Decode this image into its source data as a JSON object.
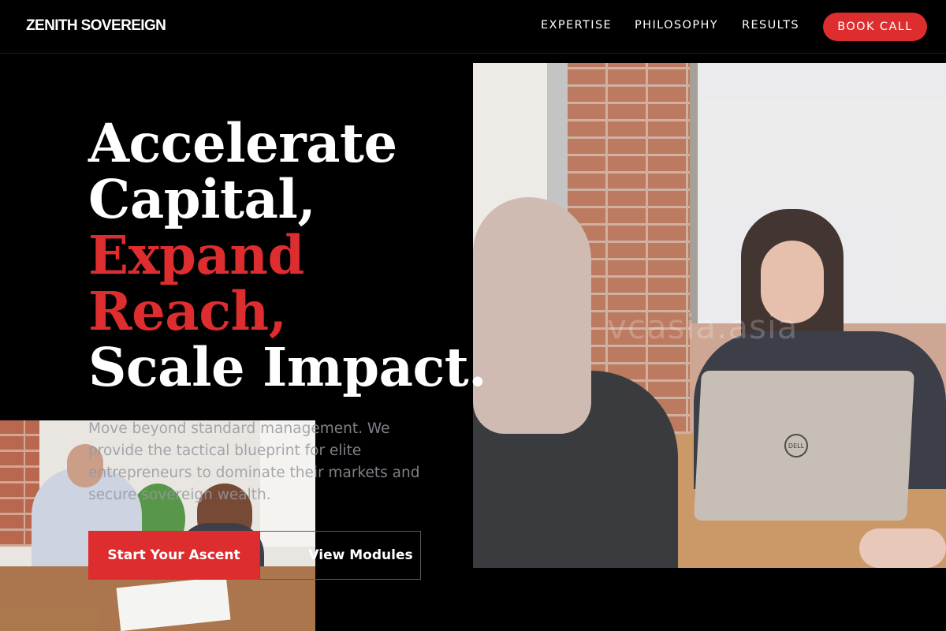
{
  "nav": {
    "logo": "ZENITH SOVEREIGN",
    "links": [
      {
        "label": "EXPERTISE"
      },
      {
        "label": "PHILOSOPHY"
      },
      {
        "label": "RESULTS"
      }
    ],
    "cta": "BOOK CALL"
  },
  "hero": {
    "headline": {
      "line1": "Accelerate",
      "line2": "Capital,",
      "line3": "Expand",
      "line4": "Reach,",
      "line5": "Scale Impact."
    },
    "lede": "Move beyond standard management. We provide the tactical blueprint for elite entrepreneurs to dominate their markets and secure sovereign wealth.",
    "primary_button": "Start Your Ascent",
    "secondary_button": "View Modules",
    "photo_watermark": "vcasia.asia",
    "laptop_brand": "DELL"
  },
  "colors": {
    "accent": "#dd2d2f",
    "background": "#000000",
    "text": "#ffffff"
  }
}
